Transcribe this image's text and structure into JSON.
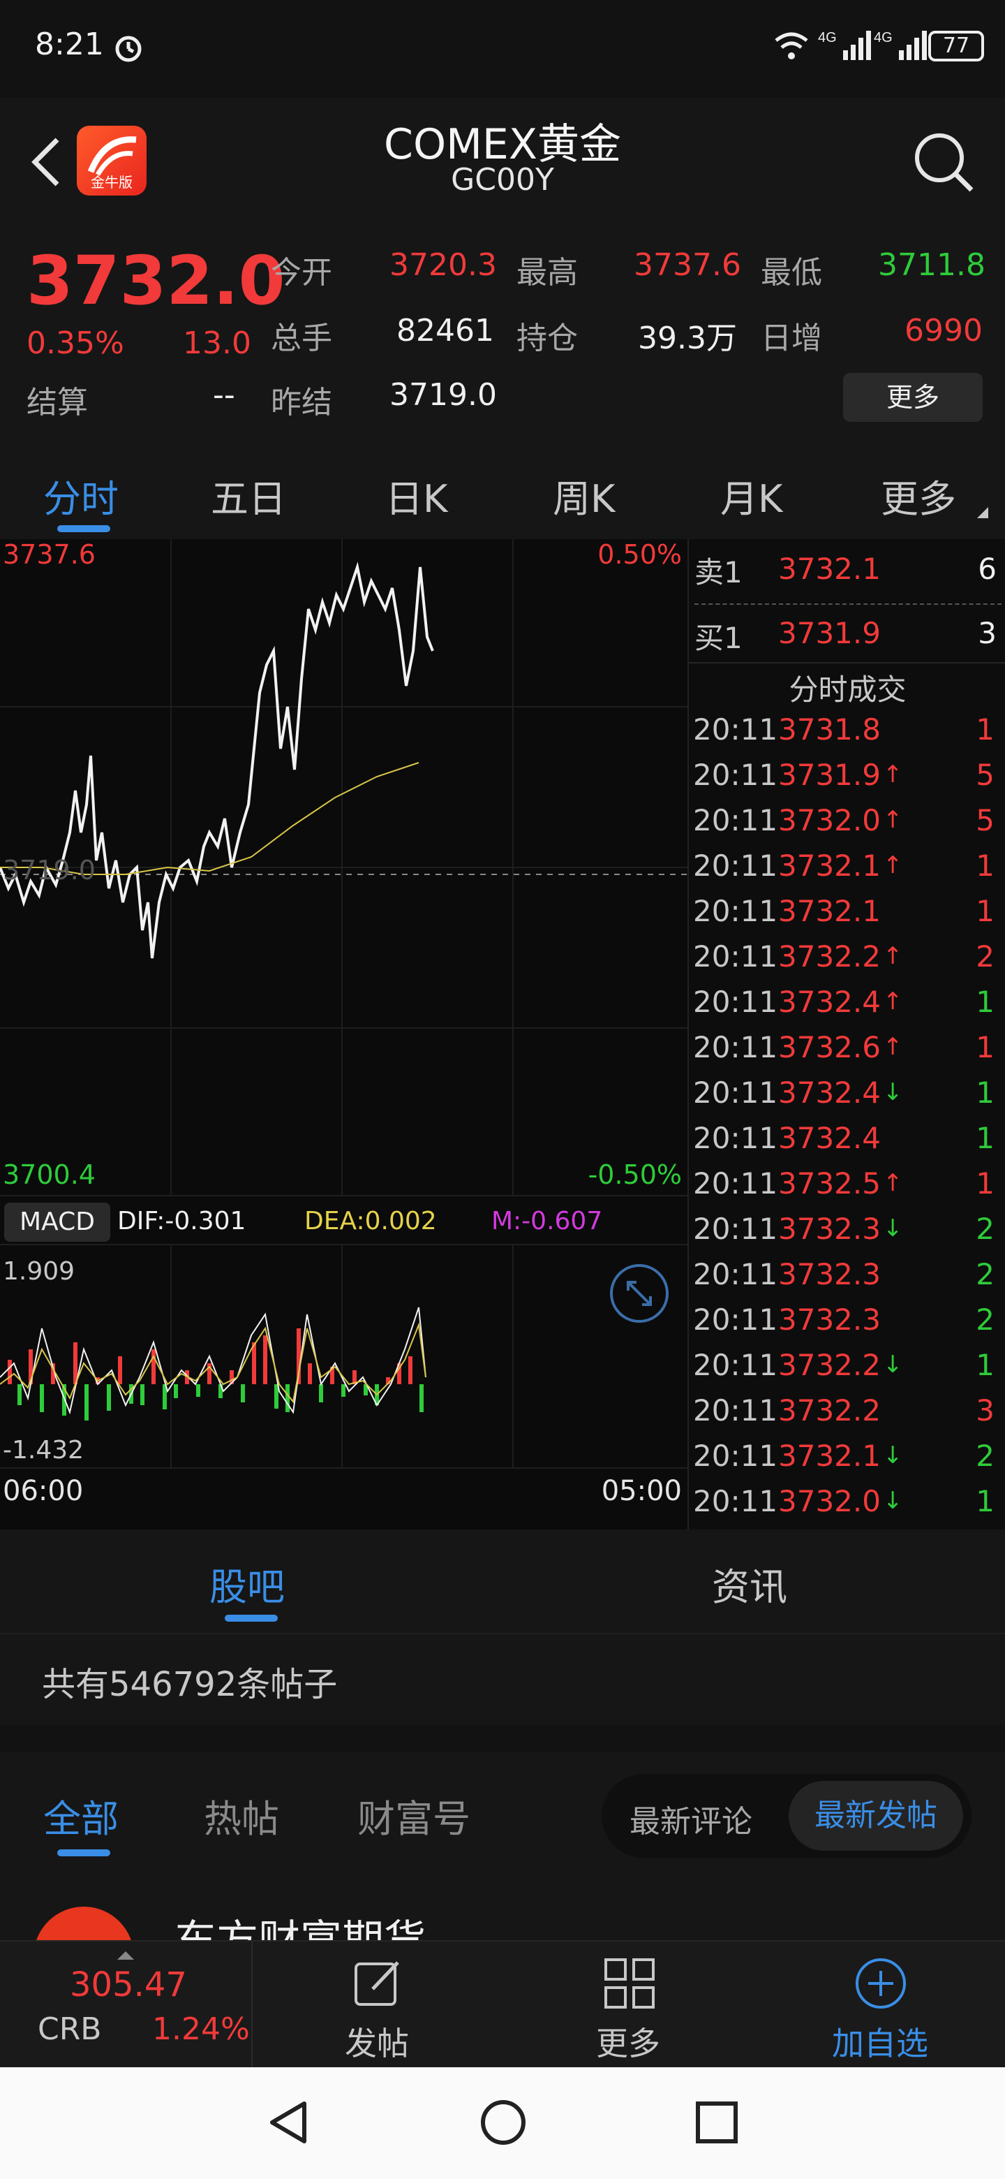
{
  "status_bar": {
    "time": "8:21",
    "network": "4G 4G",
    "battery": "77"
  },
  "header": {
    "title": "COMEX黄金",
    "code": "GC00Y",
    "app_badge": "金牛版"
  },
  "quote": {
    "price": "3732.0",
    "change_pct": "0.35%",
    "change_amt": "13.0",
    "settle_label": "结算",
    "settle_value": "--",
    "open_label": "今开",
    "open_value": "3720.3",
    "high_label": "最高",
    "high_value": "3737.6",
    "low_label": "最低",
    "low_value": "3711.8",
    "volume_label": "总手",
    "volume_value": "82461",
    "position_label": "持仓",
    "position_value": "39.3万",
    "daily_add_label": "日增",
    "daily_add_value": "6990",
    "prev_settle_label": "昨结",
    "prev_settle_value": "3719.0",
    "more_label": "更多"
  },
  "tabs": [
    "分时",
    "五日",
    "日K",
    "周K",
    "月K",
    "更多"
  ],
  "chart": {
    "top_price": "3737.6",
    "top_pct": "0.50%",
    "mid_price": "3719.0",
    "bottom_price": "3700.4",
    "bottom_pct": "-0.50%",
    "macd_label": "MACD",
    "dif": "DIF:-0.301",
    "dea": "DEA:0.002",
    "m": "M:-0.607",
    "macd_max": "1.909",
    "macd_min": "-1.432",
    "time_start": "06:00",
    "time_end": "05:00"
  },
  "book": {
    "sell1_label": "卖1",
    "sell1_price": "3732.1",
    "sell1_qty": "6",
    "buy1_label": "买1",
    "buy1_price": "3731.9",
    "buy1_qty": "3",
    "trades_title": "分时成交",
    "trades": [
      {
        "time": "20:11",
        "price": "3731.8",
        "arrow": "",
        "qty": "1",
        "color": "red"
      },
      {
        "time": "20:11",
        "price": "3731.9",
        "arrow": "↑",
        "qty": "5",
        "color": "red"
      },
      {
        "time": "20:11",
        "price": "3732.0",
        "arrow": "↑",
        "qty": "5",
        "color": "red"
      },
      {
        "time": "20:11",
        "price": "3732.1",
        "arrow": "↑",
        "qty": "1",
        "color": "red"
      },
      {
        "time": "20:11",
        "price": "3732.1",
        "arrow": "",
        "qty": "1",
        "color": "red"
      },
      {
        "time": "20:11",
        "price": "3732.2",
        "arrow": "↑",
        "qty": "2",
        "color": "red"
      },
      {
        "time": "20:11",
        "price": "3732.4",
        "arrow": "↑",
        "qty": "1",
        "color": "green"
      },
      {
        "time": "20:11",
        "price": "3732.6",
        "arrow": "↑",
        "qty": "1",
        "color": "red"
      },
      {
        "time": "20:11",
        "price": "3732.4",
        "arrow": "↓",
        "qty": "1",
        "color": "green"
      },
      {
        "time": "20:11",
        "price": "3732.4",
        "arrow": "",
        "qty": "1",
        "color": "green"
      },
      {
        "time": "20:11",
        "price": "3732.5",
        "arrow": "↑",
        "qty": "1",
        "color": "red"
      },
      {
        "time": "20:11",
        "price": "3732.3",
        "arrow": "↓",
        "qty": "2",
        "color": "green"
      },
      {
        "time": "20:11",
        "price": "3732.3",
        "arrow": "",
        "qty": "2",
        "color": "green"
      },
      {
        "time": "20:11",
        "price": "3732.3",
        "arrow": "",
        "qty": "2",
        "color": "green"
      },
      {
        "time": "20:11",
        "price": "3732.2",
        "arrow": "↓",
        "qty": "1",
        "color": "green"
      },
      {
        "time": "20:11",
        "price": "3732.2",
        "arrow": "",
        "qty": "3",
        "color": "red"
      },
      {
        "time": "20:11",
        "price": "3732.1",
        "arrow": "↓",
        "qty": "2",
        "color": "green"
      },
      {
        "time": "20:11",
        "price": "3732.0",
        "arrow": "↓",
        "qty": "1",
        "color": "green"
      }
    ]
  },
  "post_tabs": [
    "股吧",
    "资讯"
  ],
  "post_count": "共有546792条帖子",
  "filters": [
    "全部",
    "热帖",
    "财富号"
  ],
  "sort_toggle": [
    "最新评论",
    "最新发帖"
  ],
  "feed_preview": "东方财富期货",
  "bottom_bar": {
    "index_value": "305.47",
    "index_name": "CRB",
    "index_pct": "1.24%",
    "post_label": "发帖",
    "more_label": "更多",
    "add_label": "加自选"
  },
  "colors": {
    "up": "#f23a3a",
    "down": "#2ecc3a",
    "accent": "#3a8ee6",
    "bg": "#121212"
  }
}
